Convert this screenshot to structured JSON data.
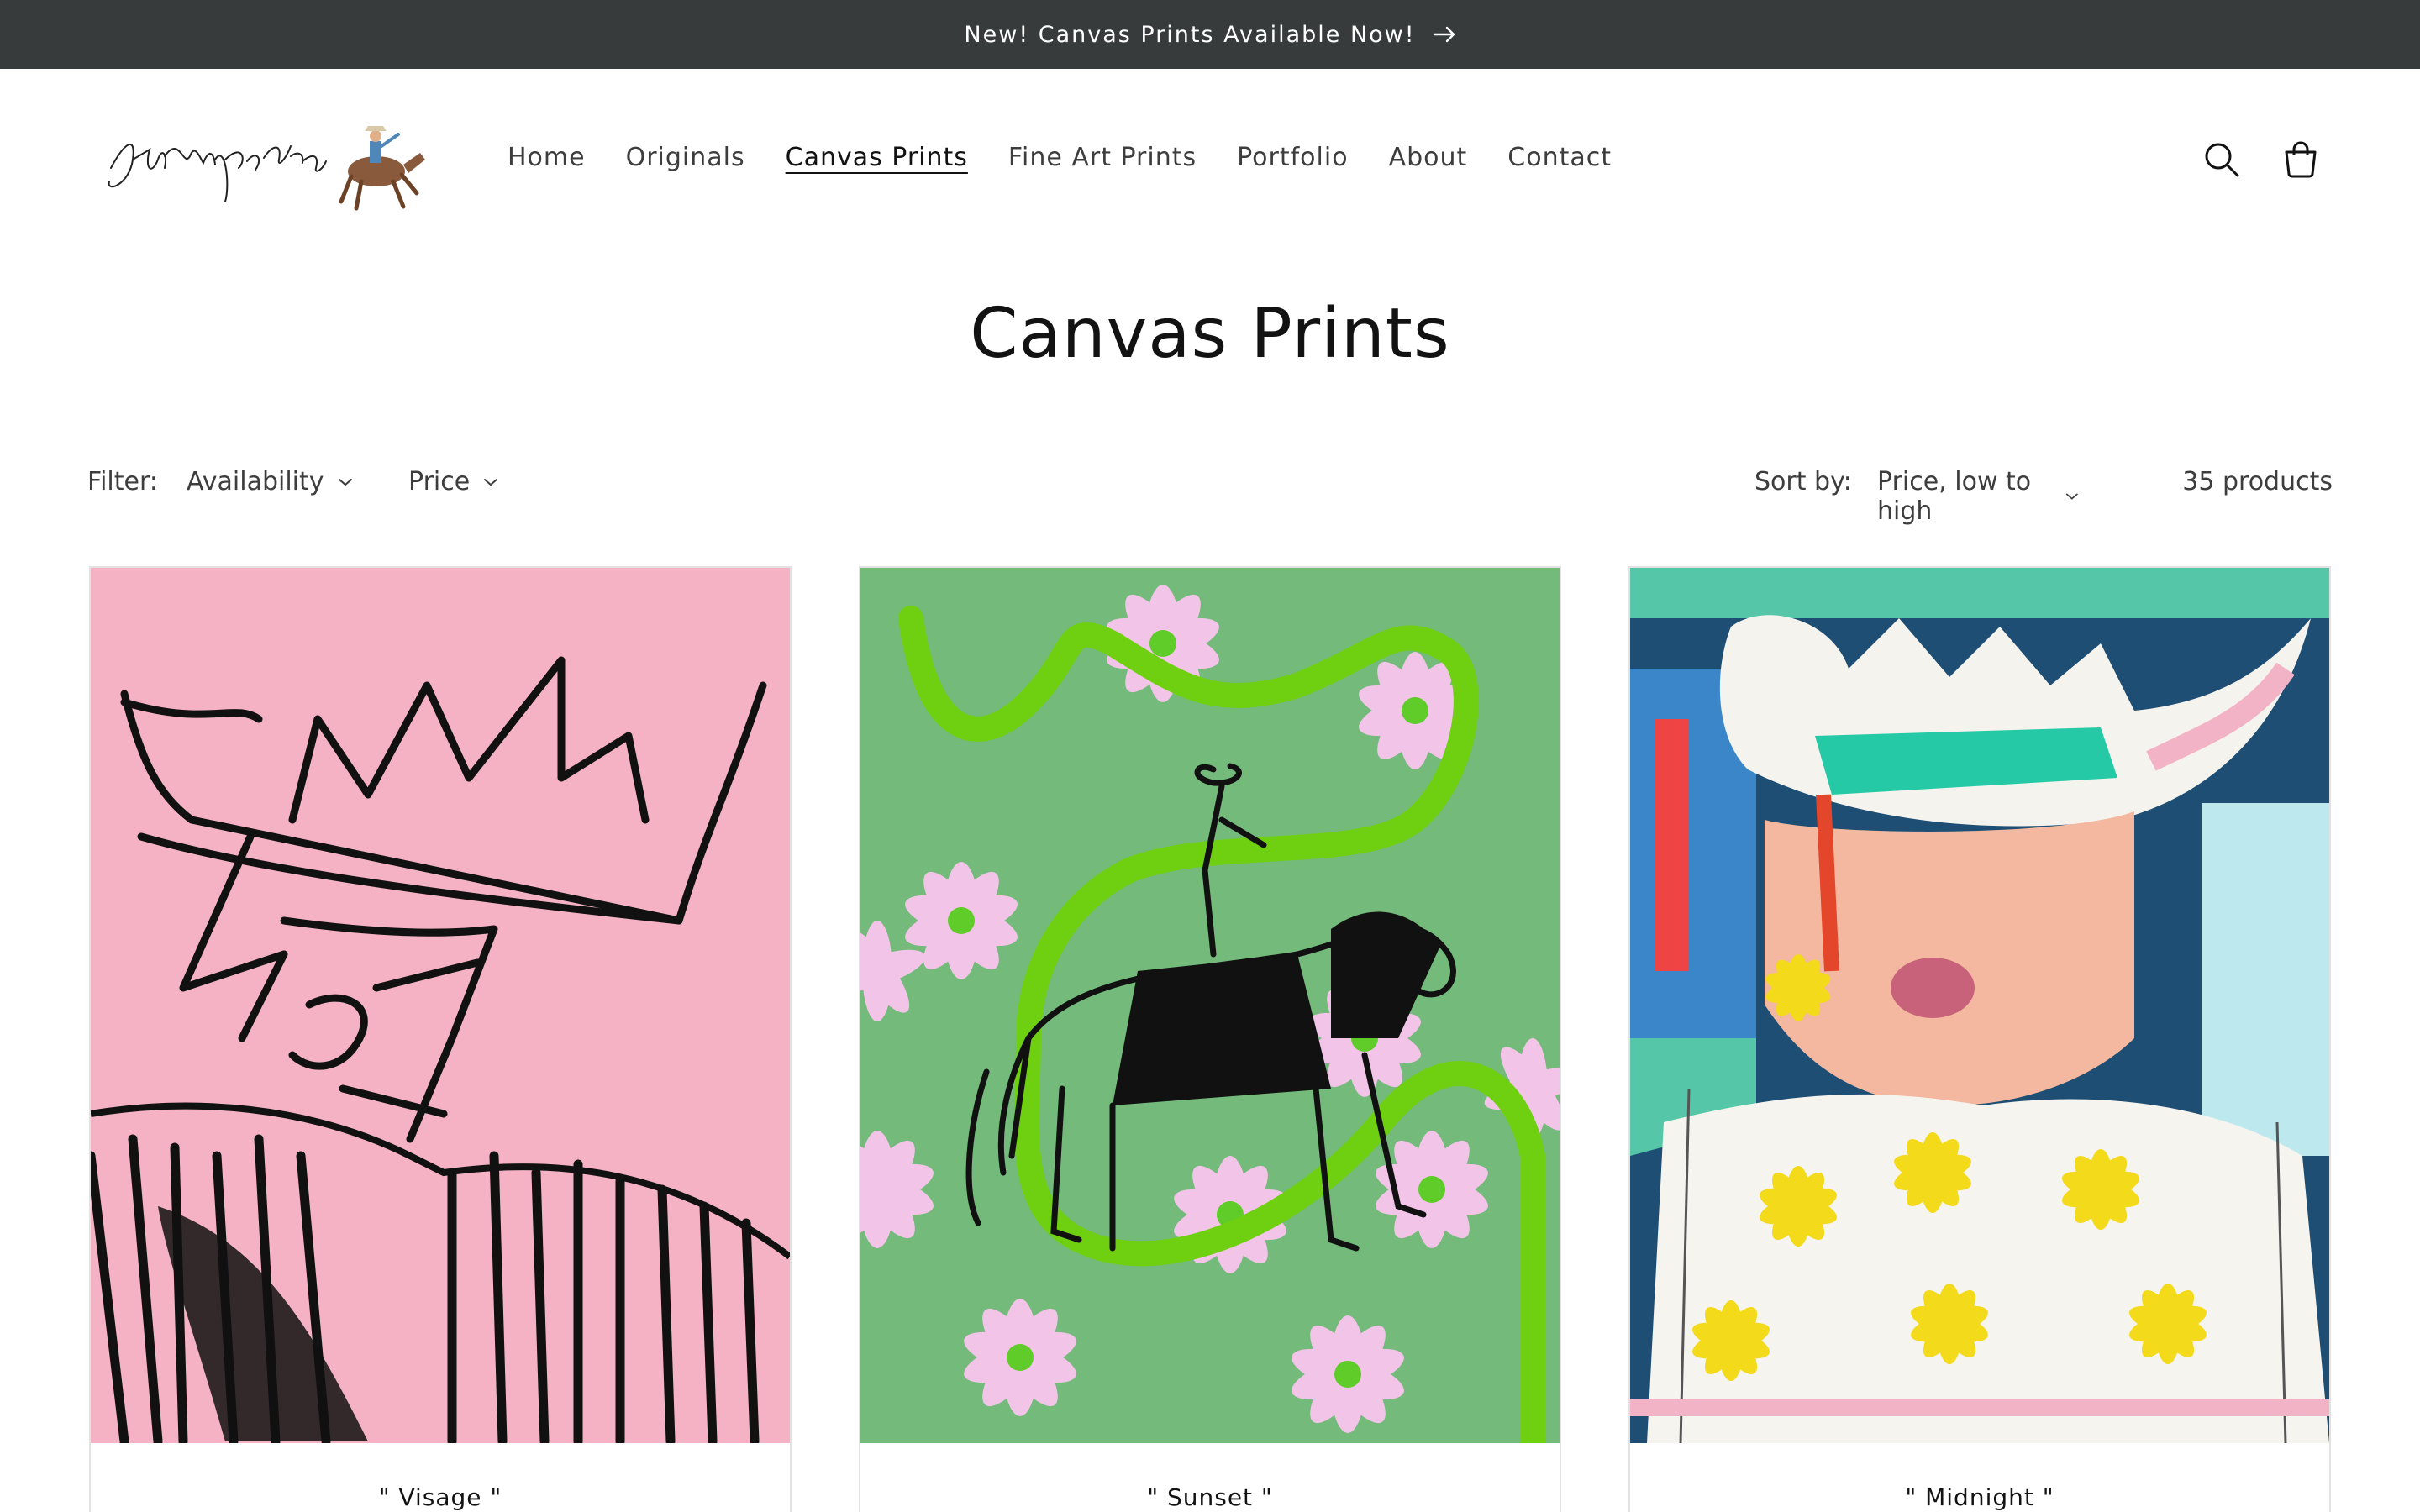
{
  "announcement": {
    "text": "New! Canvas Prints Available Now!",
    "icon": "arrow-right-icon"
  },
  "header": {
    "logo_alt": "Jakempedro",
    "nav": [
      {
        "label": "Home",
        "active": false
      },
      {
        "label": "Originals",
        "active": false
      },
      {
        "label": "Canvas Prints",
        "active": true
      },
      {
        "label": "Fine Art Prints",
        "active": false
      },
      {
        "label": "Portfolio",
        "active": false
      },
      {
        "label": "About",
        "active": false
      },
      {
        "label": "Contact",
        "active": false
      }
    ],
    "icons": [
      "search-icon",
      "cart-icon"
    ]
  },
  "page": {
    "title": "Canvas Prints"
  },
  "filters": {
    "label": "Filter:",
    "availability": "Availability",
    "price": "Price",
    "sort_label": "Sort by:",
    "sort_value": "Price, low to high",
    "count": "35 products"
  },
  "products": [
    {
      "title": "\" Visage \""
    },
    {
      "title": "\" Sunset \""
    },
    {
      "title": "\" Midnight \""
    }
  ],
  "colors": {
    "announcement_bg": "#373b3b",
    "text": "#121212",
    "card_border": "#e2e2e2"
  }
}
